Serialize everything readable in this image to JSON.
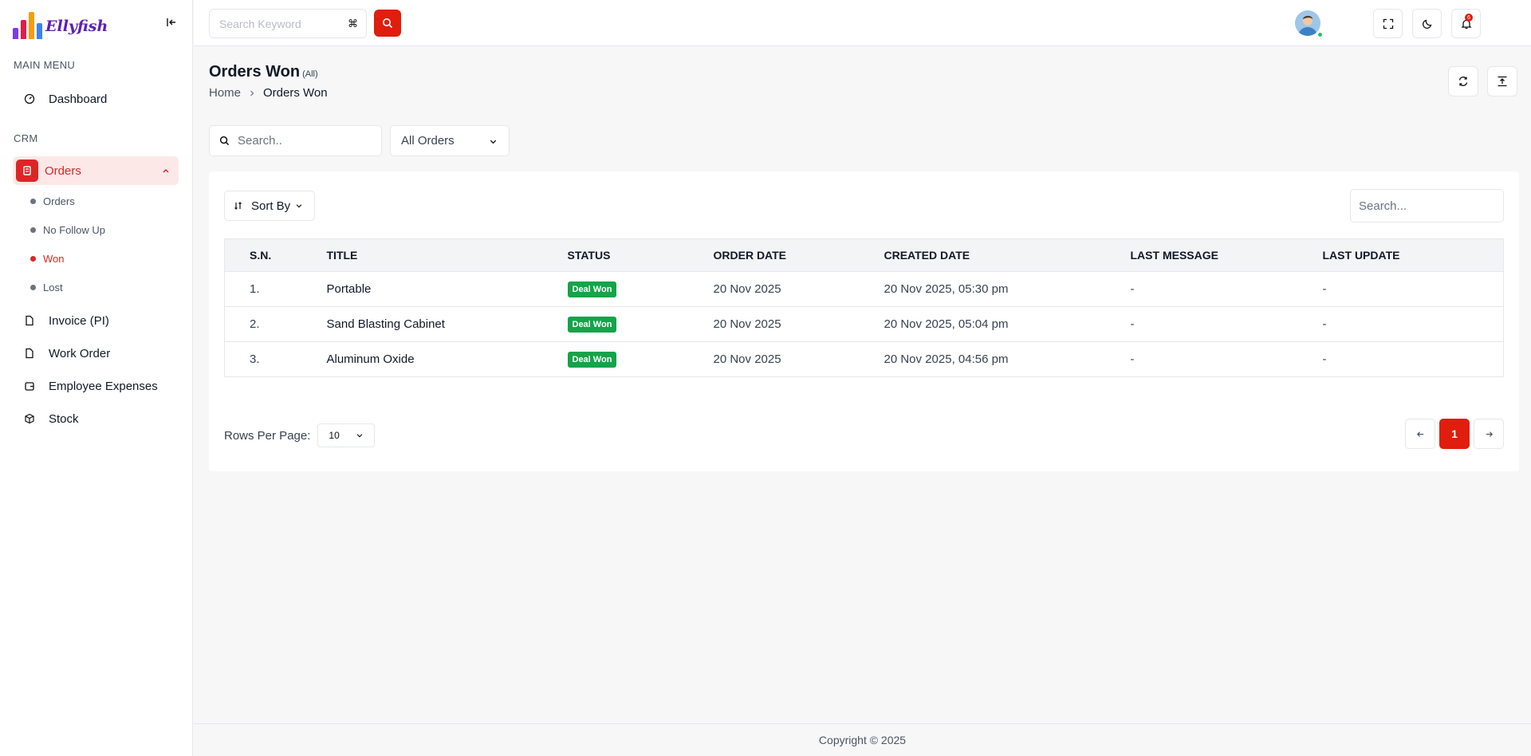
{
  "app": {
    "brand": "Ellyfish"
  },
  "topbar": {
    "search_placeholder": "Search Keyword",
    "shortcut": "⌘",
    "notifications_count": "6"
  },
  "sidebar": {
    "main_menu_label": "MAIN MENU",
    "dashboard": "Dashboard",
    "crm_label": "CRM",
    "orders": "Orders",
    "sub": {
      "orders": "Orders",
      "no_follow_up": "No Follow Up",
      "won": "Won",
      "lost": "Lost"
    },
    "invoice": "Invoice (PI)",
    "work_order": "Work Order",
    "employee_expenses": "Employee Expenses",
    "stock": "Stock"
  },
  "page": {
    "title": "Orders Won",
    "title_suffix": "(All)",
    "breadcrumb_home": "Home",
    "breadcrumb_current": "Orders Won"
  },
  "filters": {
    "search_placeholder": "Search..",
    "select_value": "All Orders"
  },
  "table": {
    "sort_label": "Sort By",
    "search_placeholder": "Search...",
    "headers": [
      "S.N.",
      "TITLE",
      "STATUS",
      "ORDER DATE",
      "CREATED DATE",
      "LAST MESSAGE",
      "LAST UPDATE"
    ],
    "rows": [
      {
        "sn": "1.",
        "title": "Portable",
        "status": "Deal Won",
        "order_date": "20 Nov 2025",
        "created_date": "20 Nov 2025, 05:30 pm",
        "last_message": "-",
        "last_update": "-"
      },
      {
        "sn": "2.",
        "title": "Sand Blasting Cabinet",
        "status": "Deal Won",
        "order_date": "20 Nov 2025",
        "created_date": "20 Nov 2025, 05:04 pm",
        "last_message": "-",
        "last_update": "-"
      },
      {
        "sn": "3.",
        "title": "Aluminum Oxide",
        "status": "Deal Won",
        "order_date": "20 Nov 2025",
        "created_date": "20 Nov 2025, 04:56 pm",
        "last_message": "-",
        "last_update": "-"
      }
    ],
    "status_color": "#16a34a"
  },
  "pagination": {
    "rows_per_page_label": "Rows Per Page:",
    "rows_per_page": "10",
    "current_page": "1"
  },
  "footer": {
    "copyright": "Copyright © 2025"
  },
  "colors": {
    "accent": "#e11d0d",
    "active_bg": "#fde8e8"
  }
}
